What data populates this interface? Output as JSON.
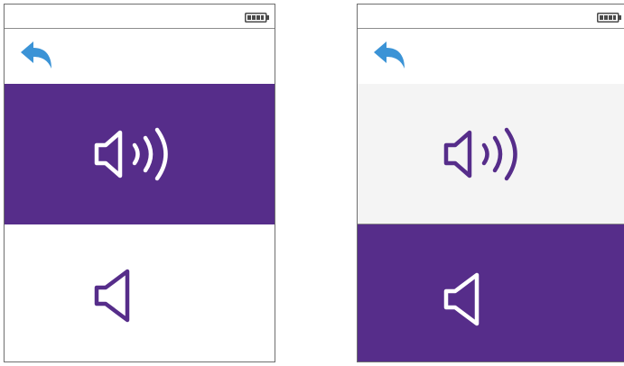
{
  "colors": {
    "accent_purple": "#562d8a",
    "back_arrow_blue": "#3b93d6",
    "panel_grey": "#f4f4f4",
    "frame_border": "#6f6f6f"
  },
  "icons": {
    "status": "battery-icon",
    "back": "back-arrow-icon",
    "loud": "speaker-loud-icon",
    "soft": "speaker-quiet-icon"
  },
  "screens": [
    {
      "id": "screen-a",
      "selected_option": "loud",
      "options": [
        {
          "key": "loud",
          "icon": "speaker-loud-icon",
          "selected": true
        },
        {
          "key": "soft",
          "icon": "speaker-quiet-icon",
          "selected": false
        }
      ]
    },
    {
      "id": "screen-b",
      "selected_option": "soft",
      "options": [
        {
          "key": "loud",
          "icon": "speaker-loud-icon",
          "selected": false
        },
        {
          "key": "soft",
          "icon": "speaker-quiet-icon",
          "selected": true
        }
      ]
    }
  ],
  "battery": {
    "level_fraction": 0.8
  }
}
